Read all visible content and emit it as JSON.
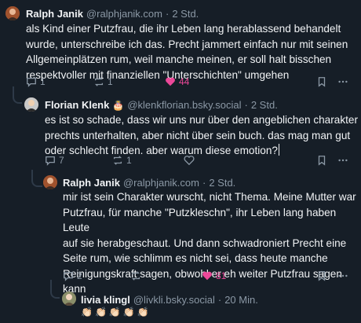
{
  "posts": [
    {
      "author": "Ralph Janik",
      "handle": "@ralphjanik.com",
      "time": "2 Std.",
      "lines": [
        "als Kind einer Putzfrau, die ihr Leben lang herablassend behandelt",
        "wurde, unterschreibe ich das. Precht jammert einfach nur mit seinen",
        "Allgemeinplätzen rum, weil manche meinen, er soll halt bisschen",
        "respektvoller mit finanziellen \"Unterschichten\" umgehen"
      ],
      "replies": "1",
      "reposts": "1",
      "likes": "44"
    },
    {
      "author": "Florian Klenk",
      "badge": "🎂",
      "handle": "@klenkflorian.bsky.social",
      "time": "2 Std.",
      "lines": [
        "es ist so schade, dass wir uns nur über den angeblichen charakter",
        "prechts unterhalten, aber nicht über sein buch. das mag man gut",
        "oder schlecht finden. aber warum diese emotion?"
      ],
      "replies": "7",
      "reposts": "1",
      "likes": ""
    },
    {
      "author": "Ralph Janik",
      "handle": "@ralphjanik.com",
      "time": "2 Std.",
      "lines": [
        "mir ist sein Charakter wurscht, nicht Thema. Meine Mutter war",
        "Putzfrau, für manche \"Putzkleschn\", ihr Leben lang haben Leute",
        "auf sie herabgeschaut. Und dann schwadroniert Precht eine",
        "Seite rum, wie schlimm es nicht sei, dass heute manche",
        "Reinigungskraft sagen, obwohl er eh weiter Putzfrau sagen",
        "kann"
      ],
      "replies": "2",
      "reposts": "",
      "likes": "81"
    },
    {
      "author": "livia klingl",
      "handle": "@livkli.bsky.social",
      "time": "20 Min.",
      "text": "👏🏻👏🏻👏🏻👏🏻👏🏻"
    }
  ],
  "separator": "·",
  "colors": {
    "like": "#ec4899",
    "muted": "#8b98a5",
    "background": "#161e27"
  }
}
